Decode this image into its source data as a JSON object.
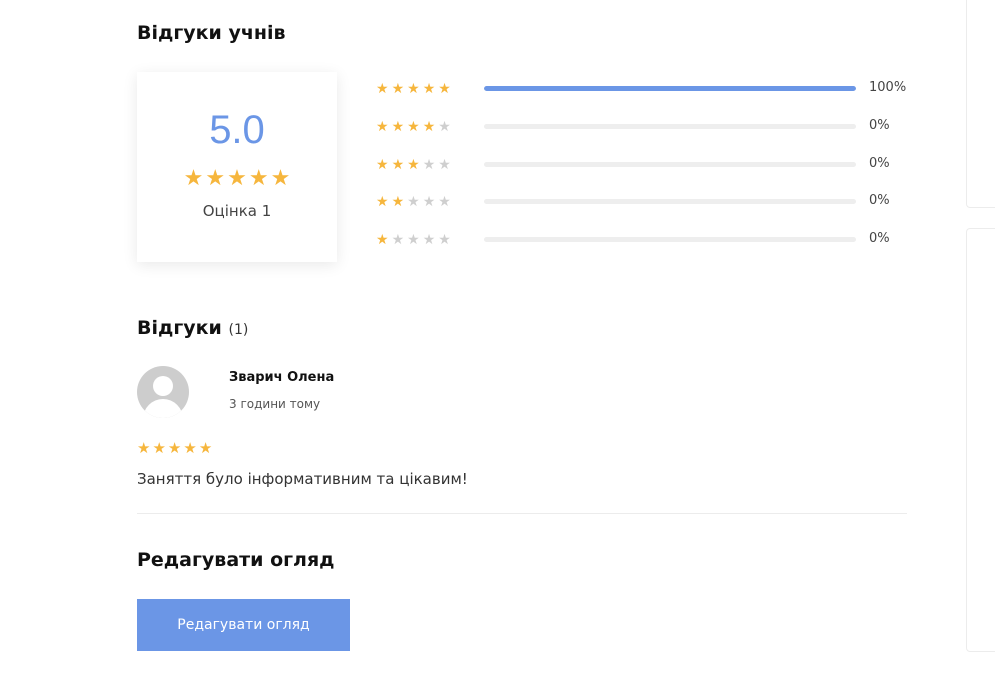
{
  "student_reviews": {
    "title": "Відгуки учнів",
    "average": "5.0",
    "average_stars": 5,
    "rating_label": "Оцінка 1",
    "distribution": [
      {
        "stars": 5,
        "fraction": 1.0,
        "percent": "100%"
      },
      {
        "stars": 4,
        "fraction": 0.0,
        "percent": "0%"
      },
      {
        "stars": 3,
        "fraction": 0.0,
        "percent": "0%"
      },
      {
        "stars": 2,
        "fraction": 0.0,
        "percent": "0%"
      },
      {
        "stars": 1,
        "fraction": 0.0,
        "percent": "0%"
      }
    ]
  },
  "reviews": {
    "title": "Відгуки",
    "count": "(1)",
    "items": [
      {
        "author": "Зварич Олена",
        "time": "3 години тому",
        "stars": 5,
        "text": "Заняття було інформативним та цікавим!"
      }
    ]
  },
  "edit_review": {
    "title": "Редагувати огляд",
    "button_label": "Редагувати огляд"
  },
  "colors": {
    "accent": "#6b96e6",
    "star_filled": "#f6b63d",
    "star_empty": "#cfcfcf"
  },
  "icons": {
    "star": "star-icon",
    "avatar": "user-avatar-icon"
  }
}
